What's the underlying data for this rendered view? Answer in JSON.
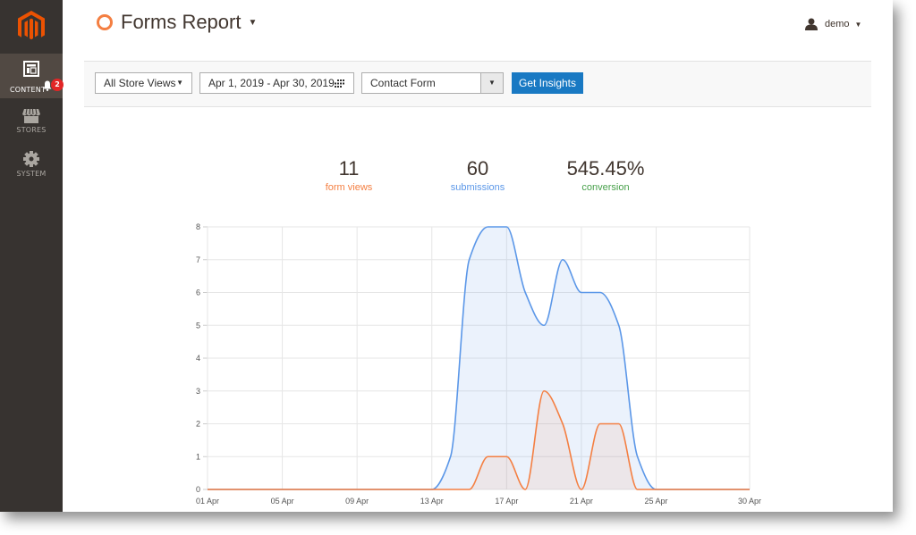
{
  "sidebar": {
    "items": [
      {
        "label": "CONTENT",
        "icon": "content-layout-icon",
        "active": true,
        "notifications": "2"
      },
      {
        "label": "STORES",
        "icon": "store-awning-icon",
        "active": false
      },
      {
        "label": "SYSTEM",
        "icon": "gear-icon",
        "active": false
      }
    ]
  },
  "header": {
    "title": "Forms Report",
    "user": "demo"
  },
  "toolbar": {
    "store_view": "All Store Views",
    "date_range": "Apr 1, 2019 - Apr 30, 2019",
    "form": "Contact Form",
    "submit_label": "Get Insights"
  },
  "stats": {
    "form_views": {
      "value": "11",
      "label": "form views"
    },
    "submissions": {
      "value": "60",
      "label": "submissions"
    },
    "conversion": {
      "value": "545.45%",
      "label": "conversion"
    }
  },
  "colors": {
    "brand": "#eb5202",
    "form_views": "#f47f42",
    "submissions": "#5b97e8",
    "conversion": "#47a04a",
    "button": "#1979c3",
    "sidebar": "#373330"
  },
  "chart_data": {
    "type": "area",
    "x": [
      "01 Apr",
      "02 Apr",
      "03 Apr",
      "04 Apr",
      "05 Apr",
      "06 Apr",
      "07 Apr",
      "08 Apr",
      "09 Apr",
      "10 Apr",
      "11 Apr",
      "12 Apr",
      "13 Apr",
      "14 Apr",
      "15 Apr",
      "16 Apr",
      "17 Apr",
      "18 Apr",
      "19 Apr",
      "20 Apr",
      "21 Apr",
      "22 Apr",
      "23 Apr",
      "24 Apr",
      "25 Apr",
      "26 Apr",
      "27 Apr",
      "28 Apr",
      "29 Apr",
      "30 Apr"
    ],
    "x_tick_labels": [
      "01 Apr",
      "05 Apr",
      "09 Apr",
      "13 Apr",
      "17 Apr",
      "21 Apr",
      "25 Apr",
      "30 Apr"
    ],
    "y_tick_labels": [
      "0",
      "1",
      "2",
      "3",
      "4",
      "5",
      "6",
      "7",
      "8"
    ],
    "ylim": [
      0,
      8
    ],
    "grid": true,
    "series": [
      {
        "name": "submissions",
        "color": "#5b97e8",
        "values": [
          0,
          0,
          0,
          0,
          0,
          0,
          0,
          0,
          0,
          0,
          0,
          0,
          0,
          1,
          7,
          8,
          8,
          6,
          5,
          7,
          6,
          6,
          5,
          1,
          0,
          0,
          0,
          0,
          0,
          0
        ]
      },
      {
        "name": "form views",
        "color": "#f47f42",
        "values": [
          0,
          0,
          0,
          0,
          0,
          0,
          0,
          0,
          0,
          0,
          0,
          0,
          0,
          0,
          0,
          1,
          1,
          0,
          3,
          2,
          0,
          2,
          2,
          0,
          0,
          0,
          0,
          0,
          0,
          0
        ]
      }
    ]
  }
}
